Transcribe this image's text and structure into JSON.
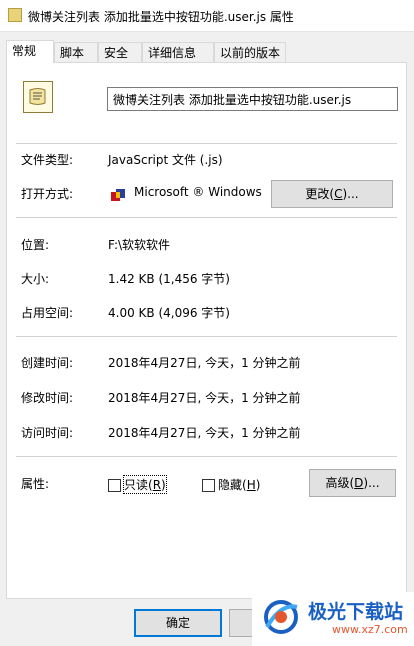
{
  "window": {
    "title": "微博关注列表 添加批量选中按钮功能.user.js 属性"
  },
  "tabs": [
    "常规",
    "脚本",
    "安全",
    "详细信息",
    "以前的版本"
  ],
  "file": {
    "name": "微博关注列表 添加批量选中按钮功能.user.js"
  },
  "properties": {
    "type_label": "文件类型:",
    "type_value": "JavaScript 文件 (.js)",
    "open_label": "打开方式:",
    "open_value": "Microsoft ® Windows",
    "change_btn_pre": "更改(",
    "change_btn_key": "C",
    "change_btn_post": ")...",
    "location_label": "位置:",
    "location_value": "F:\\软软软件",
    "size_label": "大小:",
    "size_value": "1.42 KB (1,456 字节)",
    "disk_label": "占用空间:",
    "disk_value": "4.00 KB (4,096 字节)",
    "created_label": "创建时间:",
    "created_value": "2018年4月27日, 今天，1 分钟之前",
    "modified_label": "修改时间:",
    "modified_value": "2018年4月27日, 今天，1 分钟之前",
    "accessed_label": "访问时间:",
    "accessed_value": "2018年4月27日, 今天，1 分钟之前",
    "attributes_label": "属性:",
    "readonly_pre": "只读(",
    "readonly_key": "R",
    "readonly_post": ")",
    "readonly_checked": false,
    "hidden_pre": "隐藏(",
    "hidden_key": "H",
    "hidden_post": ")",
    "hidden_checked": false,
    "advanced_pre": "高级(",
    "advanced_key": "D",
    "advanced_post": ")..."
  },
  "footer": {
    "ok_label": "确定"
  },
  "watermark": {
    "title": "极光下载站",
    "url": "www.xz7.com"
  },
  "icons": {
    "title": "script-file-icon",
    "file": "script-file-icon",
    "app": "windows-script-host-icon",
    "logo": "aurora-logo-icon"
  },
  "colors": {
    "accent": "#0078d7",
    "watermark_blue": "#1a60c2",
    "watermark_red": "#e4572e"
  }
}
